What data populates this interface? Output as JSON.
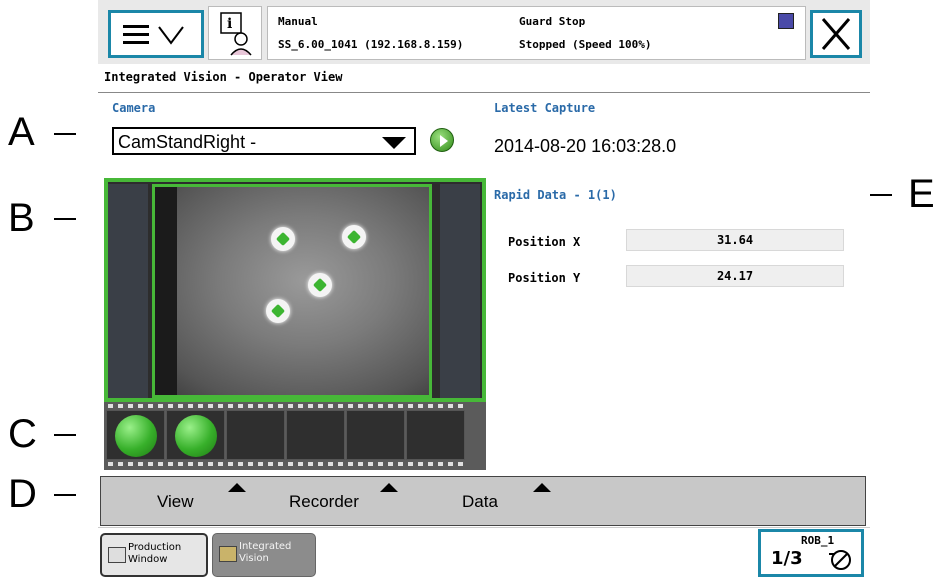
{
  "callouts": {
    "a": "A",
    "b": "B",
    "c": "C",
    "d": "D",
    "e": "E"
  },
  "status": {
    "mode": "Manual",
    "controller": "SS_6.00_1041 (192.168.8.159)",
    "state": "Guard Stop",
    "speed_state": "Stopped (Speed 100%)"
  },
  "window_title": "Integrated Vision - Operator View",
  "camera": {
    "label": "Camera",
    "selected": "CamStandRight -"
  },
  "latest_capture": {
    "label": "Latest Capture",
    "timestamp": "2014-08-20 16:03:28.0"
  },
  "rapid_data": {
    "title": "Rapid Data - 1(1)",
    "rows": [
      {
        "label": "Position X",
        "value": "31.64"
      },
      {
        "label": "Position Y",
        "value": "24.17"
      }
    ]
  },
  "tabs": [
    "View",
    "Recorder",
    "Data"
  ],
  "taskbar": {
    "production_line1": "Production",
    "production_line2": "Window",
    "vision_line1": "Integrated",
    "vision_line2": "Vision",
    "robot": "ROB_1",
    "fraction": "1/3"
  },
  "colors": {
    "accent": "#1b87a8",
    "ok_green": "#47b838",
    "label_blue": "#2a6aa8"
  }
}
